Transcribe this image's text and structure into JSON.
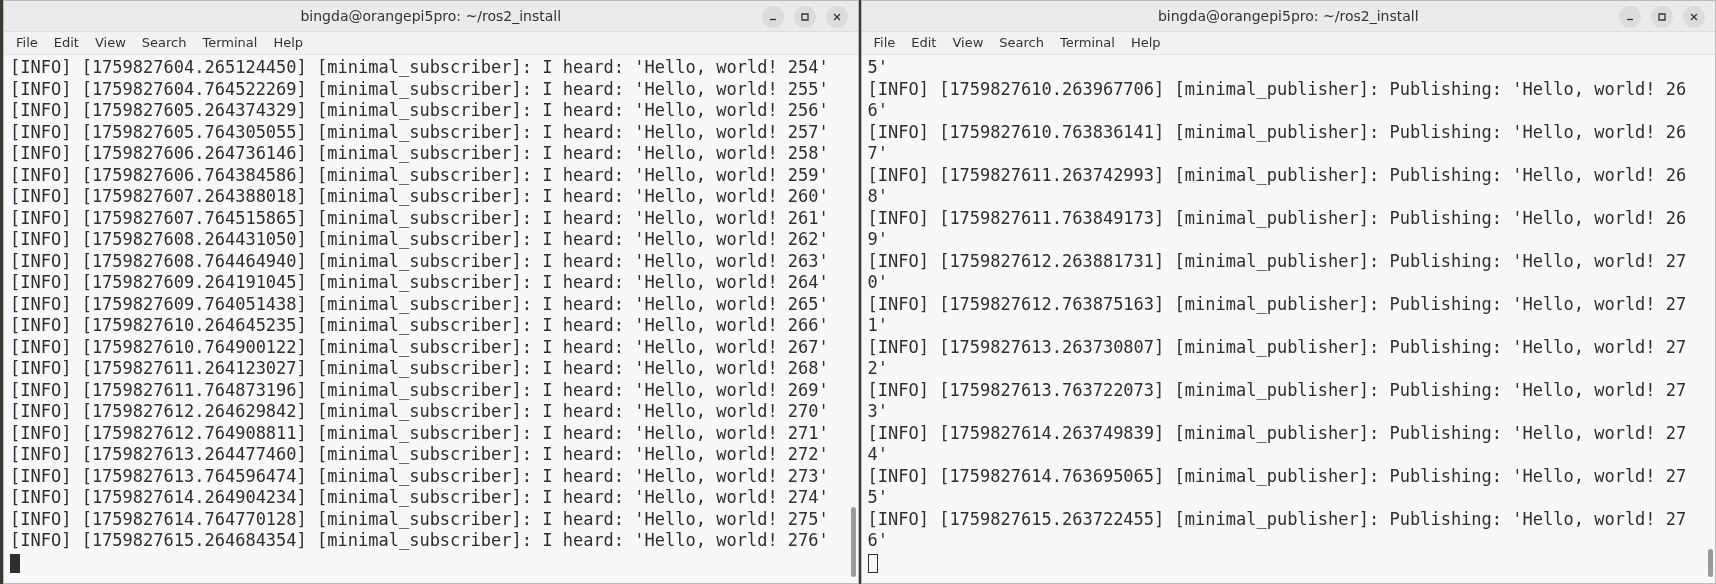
{
  "windows": [
    {
      "title": "bingda@orangepi5pro: ~/ros2_install",
      "focused": true,
      "menu": [
        "File",
        "Edit",
        "View",
        "Search",
        "Terminal",
        "Help"
      ],
      "lines": [
        "[INFO] [1759827604.265124450] [minimal_subscriber]: I heard: 'Hello, world! 254'",
        "[INFO] [1759827604.764522269] [minimal_subscriber]: I heard: 'Hello, world! 255'",
        "[INFO] [1759827605.264374329] [minimal_subscriber]: I heard: 'Hello, world! 256'",
        "[INFO] [1759827605.764305055] [minimal_subscriber]: I heard: 'Hello, world! 257'",
        "[INFO] [1759827606.264736146] [minimal_subscriber]: I heard: 'Hello, world! 258'",
        "[INFO] [1759827606.764384586] [minimal_subscriber]: I heard: 'Hello, world! 259'",
        "[INFO] [1759827607.264388018] [minimal_subscriber]: I heard: 'Hello, world! 260'",
        "[INFO] [1759827607.764515865] [minimal_subscriber]: I heard: 'Hello, world! 261'",
        "[INFO] [1759827608.264431050] [minimal_subscriber]: I heard: 'Hello, world! 262'",
        "[INFO] [1759827608.764464940] [minimal_subscriber]: I heard: 'Hello, world! 263'",
        "[INFO] [1759827609.264191045] [minimal_subscriber]: I heard: 'Hello, world! 264'",
        "[INFO] [1759827609.764051438] [minimal_subscriber]: I heard: 'Hello, world! 265'",
        "[INFO] [1759827610.264645235] [minimal_subscriber]: I heard: 'Hello, world! 266'",
        "[INFO] [1759827610.764900122] [minimal_subscriber]: I heard: 'Hello, world! 267'",
        "[INFO] [1759827611.264123027] [minimal_subscriber]: I heard: 'Hello, world! 268'",
        "[INFO] [1759827611.764873196] [minimal_subscriber]: I heard: 'Hello, world! 269'",
        "[INFO] [1759827612.264629842] [minimal_subscriber]: I heard: 'Hello, world! 270'",
        "[INFO] [1759827612.764908811] [minimal_subscriber]: I heard: 'Hello, world! 271'",
        "[INFO] [1759827613.264477460] [minimal_subscriber]: I heard: 'Hello, world! 272'",
        "[INFO] [1759827613.764596474] [minimal_subscriber]: I heard: 'Hello, world! 273'",
        "[INFO] [1759827614.264904234] [minimal_subscriber]: I heard: 'Hello, world! 274'",
        "[INFO] [1759827614.764770128] [minimal_subscriber]: I heard: 'Hello, world! 275'",
        "[INFO] [1759827615.264684354] [minimal_subscriber]: I heard: 'Hello, world! 276'"
      ]
    },
    {
      "title": "bingda@orangepi5pro: ~/ros2_install",
      "focused": false,
      "menu": [
        "File",
        "Edit",
        "View",
        "Search",
        "Terminal",
        "Help"
      ],
      "lines": [
        "5'",
        "[INFO] [1759827610.263967706] [minimal_publisher]: Publishing: 'Hello, world! 26",
        "6'",
        "[INFO] [1759827610.763836141] [minimal_publisher]: Publishing: 'Hello, world! 26",
        "7'",
        "[INFO] [1759827611.263742993] [minimal_publisher]: Publishing: 'Hello, world! 26",
        "8'",
        "[INFO] [1759827611.763849173] [minimal_publisher]: Publishing: 'Hello, world! 26",
        "9'",
        "[INFO] [1759827612.263881731] [minimal_publisher]: Publishing: 'Hello, world! 27",
        "0'",
        "[INFO] [1759827612.763875163] [minimal_publisher]: Publishing: 'Hello, world! 27",
        "1'",
        "[INFO] [1759827613.263730807] [minimal_publisher]: Publishing: 'Hello, world! 27",
        "2'",
        "[INFO] [1759827613.763722073] [minimal_publisher]: Publishing: 'Hello, world! 27",
        "3'",
        "[INFO] [1759827614.263749839] [minimal_publisher]: Publishing: 'Hello, world! 27",
        "4'",
        "[INFO] [1759827614.763695065] [minimal_publisher]: Publishing: 'Hello, world! 27",
        "5'",
        "[INFO] [1759827615.263722455] [minimal_publisher]: Publishing: 'Hello, world! 27",
        "6'"
      ]
    }
  ]
}
